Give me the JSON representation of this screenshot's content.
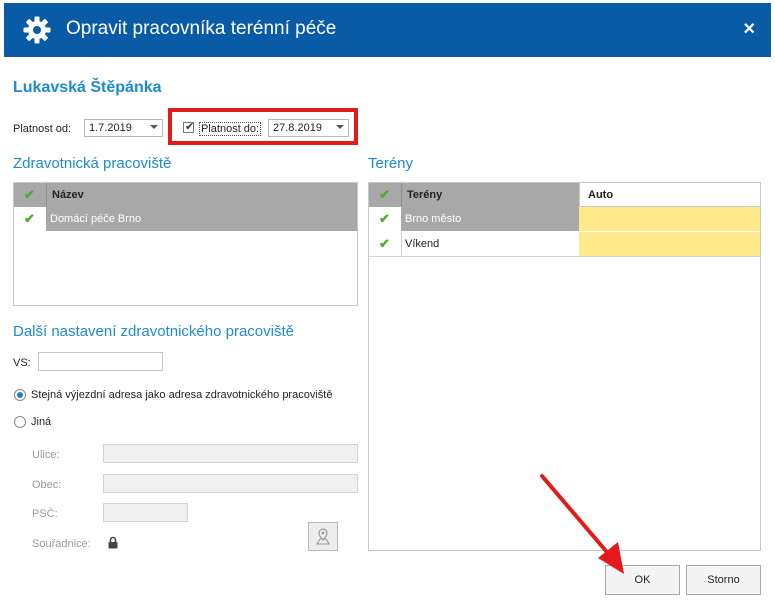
{
  "window": {
    "title": "Opravit pracovníka terénní péče",
    "close_icon": "×"
  },
  "person_name": "Lukavská Štěpánka",
  "validity": {
    "from_label": "Platnost od:",
    "from_value": "1.7.2019",
    "to_label": "Platnost do:",
    "to_checked": true,
    "to_value": "27.8.2019"
  },
  "workplaces": {
    "title": "Zdravotnická pracoviště",
    "column": "Název",
    "rows": [
      "Domácí péče Brno"
    ]
  },
  "terrains": {
    "title": "Terény",
    "columns": [
      "Terény",
      "Auto"
    ],
    "rows": [
      {
        "name": "Brno město",
        "auto": ""
      },
      {
        "name": "Víkend",
        "auto": ""
      }
    ]
  },
  "settings": {
    "title": "Další nastavení zdravotnického pracoviště",
    "vs_label": "VS:",
    "vs_value": "",
    "radio_same": "Stejná výjezdní adresa jako adresa zdravotnického pracoviště",
    "radio_other": "Jiná",
    "street_label": "Ulice:",
    "city_label": "Obec:",
    "zip_label": "PSČ:",
    "coords_label": "Souřadnice:"
  },
  "buttons": {
    "ok": "OK",
    "cancel": "Storno"
  },
  "colors": {
    "title_bar": "#0a5ba5",
    "accent": "#1e8ad2",
    "highlight": "#e21a1a",
    "auto_cell": "#ffe98a",
    "check": "#4caf2a"
  }
}
